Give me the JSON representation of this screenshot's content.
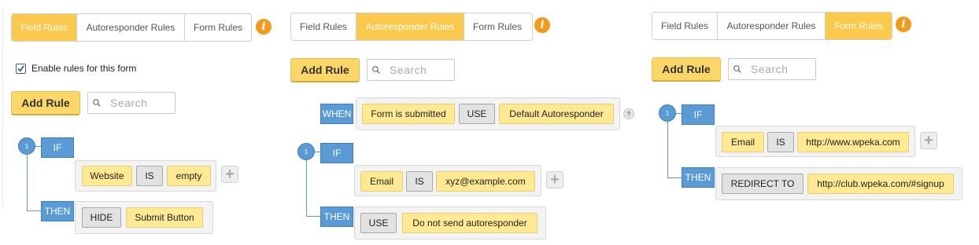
{
  "panel1": {
    "tabs": [
      {
        "label": "Field Rules",
        "active": true
      },
      {
        "label": "Autoresponder Rules",
        "active": false
      },
      {
        "label": "Form Rules",
        "active": false
      }
    ],
    "enable_label": "Enable rules for this form",
    "enable_checked": true,
    "add_rule_label": "Add Rule",
    "search_placeholder": "Search",
    "rule": {
      "number": "1",
      "if_label": "IF",
      "condition": {
        "field": "Website",
        "operator": "IS",
        "value": "empty"
      },
      "then_label": "THEN",
      "action": {
        "verb": "HIDE",
        "target": "Submit Button"
      }
    }
  },
  "panel2": {
    "tabs": [
      {
        "label": "Field Rules",
        "active": false
      },
      {
        "label": "Autoresponder Rules",
        "active": true
      },
      {
        "label": "Form Rules",
        "active": false
      }
    ],
    "add_rule_label": "Add Rule",
    "search_placeholder": "Search",
    "when_label": "WHEN",
    "when": {
      "event": "Form is submitted",
      "use_label": "USE",
      "autoresponder": "Default Autoresponder"
    },
    "help_glyph": "?",
    "rule": {
      "number": "1",
      "if_label": "IF",
      "condition": {
        "field": "Email",
        "operator": "IS",
        "value": "xyz@example.com"
      },
      "then_label": "THEN",
      "action": {
        "verb": "USE",
        "target": "Do not send autoresponder"
      }
    }
  },
  "panel3": {
    "tabs": [
      {
        "label": "Field Rules",
        "active": false
      },
      {
        "label": "Autoresponder Rules",
        "active": false
      },
      {
        "label": "Form Rules",
        "active": true
      }
    ],
    "add_rule_label": "Add Rule",
    "search_placeholder": "Search",
    "rule": {
      "number": "1",
      "if_label": "IF",
      "condition": {
        "field": "Email",
        "operator": "IS",
        "value": "http://www.wpeka.com"
      },
      "then_label": "THEN",
      "action": {
        "verb": "REDIRECT TO",
        "target": "http://club.wpeka.com/#signup"
      }
    }
  },
  "info_glyph": "i",
  "plus_glyph": "+",
  "colors": {
    "accent": "#fbc94c",
    "info": "#f39a1b",
    "keyword": "#5b9bd5",
    "token": "#ffe992"
  }
}
